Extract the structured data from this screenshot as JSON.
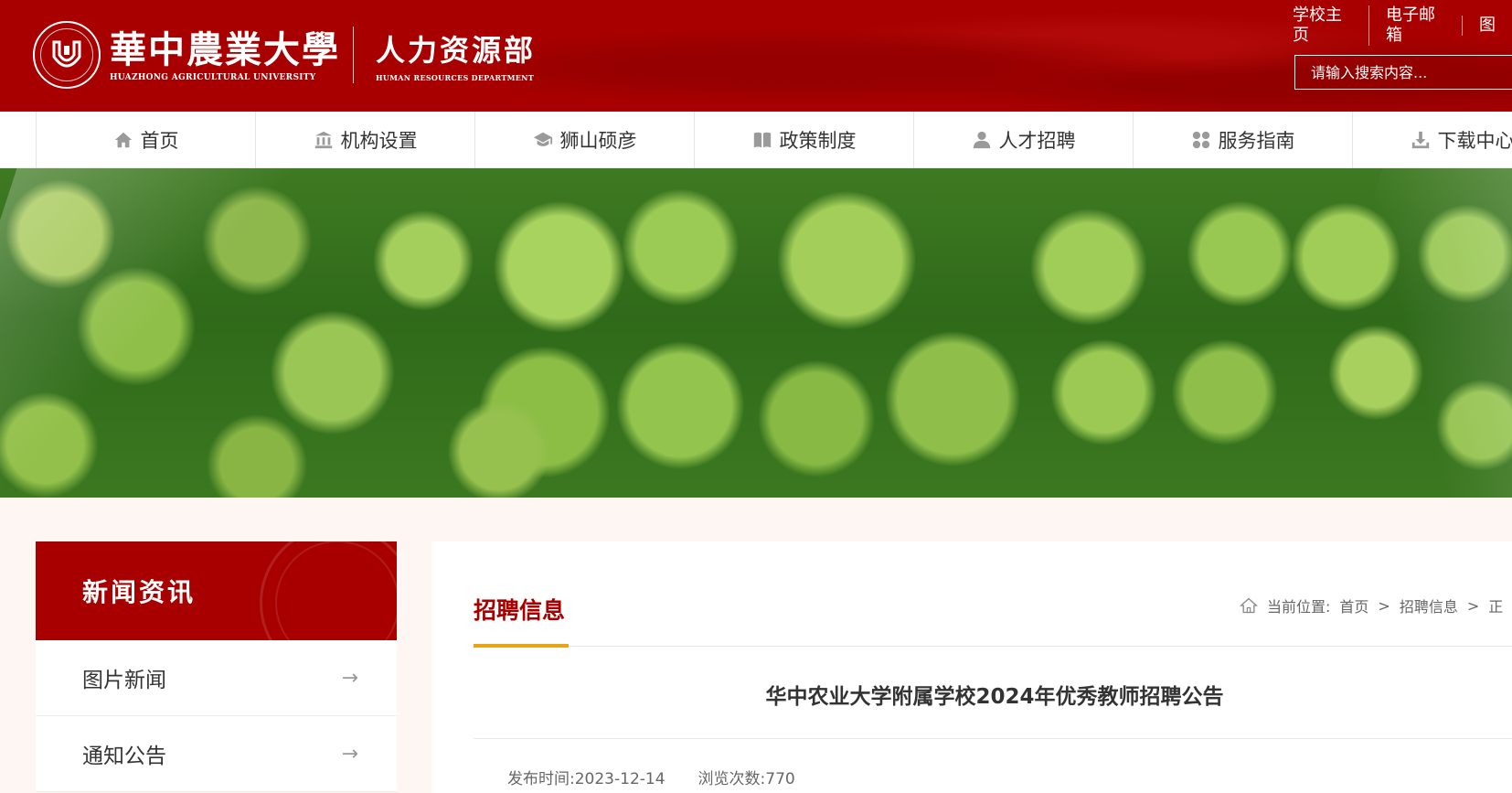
{
  "header": {
    "university_cn": "華中農業大學",
    "university_en": "HUAZHONG AGRICULTURAL UNIVERSITY",
    "department_cn": "人力资源部",
    "department_en": "HUMAN RESOURCES DEPARTMENT",
    "top_links": [
      "学校主页",
      "电子邮箱",
      "图"
    ],
    "search_placeholder": "请输入搜索内容...",
    "brand_color": "#a80000"
  },
  "nav": {
    "items": [
      {
        "label": "首页",
        "icon": "home-icon"
      },
      {
        "label": "机构设置",
        "icon": "institution-icon"
      },
      {
        "label": "狮山硕彦",
        "icon": "graduation-cap-icon"
      },
      {
        "label": "政策制度",
        "icon": "book-icon"
      },
      {
        "label": "人才招聘",
        "icon": "user-icon"
      },
      {
        "label": "服务指南",
        "icon": "grid-icon"
      },
      {
        "label": "下载中心",
        "icon": "download-icon"
      }
    ]
  },
  "sidebar": {
    "title": "新闻资讯",
    "items": [
      {
        "label": "图片新闻"
      },
      {
        "label": "通知公告"
      }
    ]
  },
  "main": {
    "section_title": "招聘信息",
    "accent_color": "#e8a317",
    "breadcrumb": {
      "prefix": "当前位置:",
      "items": [
        "首页",
        "招聘信息",
        "正"
      ]
    },
    "article": {
      "title": "华中农业大学附属学校2024年优秀教师招聘公告",
      "publish_label": "发布时间:",
      "publish_date": "2023-12-14",
      "views_label": "浏览次数:",
      "views": "770"
    }
  }
}
